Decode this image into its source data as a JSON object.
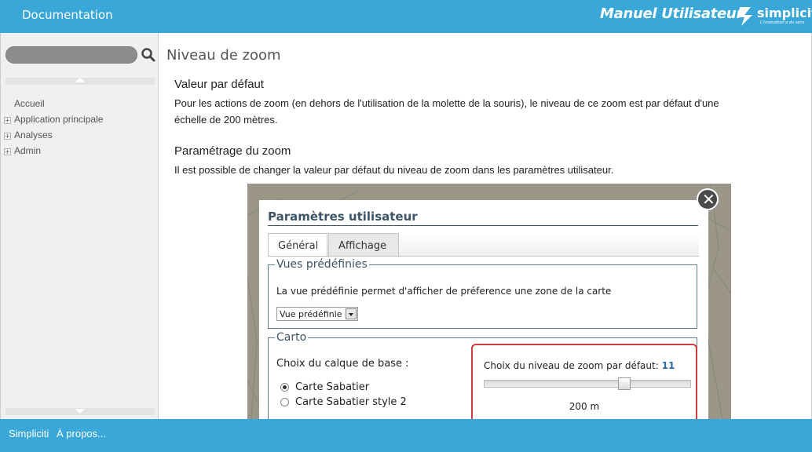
{
  "header": {
    "doc_label": "Documentation",
    "manual_label": "Manuel Utilisateur",
    "logo_name": "simpliciti",
    "logo_tagline": "L'innovation a du sens"
  },
  "sidebar": {
    "search_placeholder": "",
    "items": [
      {
        "label": "Accueil",
        "expandable": false
      },
      {
        "label": "Application principale",
        "expandable": true
      },
      {
        "label": "Analyses",
        "expandable": true
      },
      {
        "label": "Admin",
        "expandable": true
      }
    ]
  },
  "content": {
    "page_title": "Niveau de zoom",
    "section1_title": "Valeur par défaut",
    "section1_line1": "Pour les actions de zoom (en dehors de l'utilisation de la molette de la souris), le niveau de ce zoom est par défaut d'une",
    "section1_line2": "échelle de 200 mètres.",
    "section2_title": "Paramétrage du zoom",
    "section2_text": "Il est possible de changer la valeur par défaut du niveau de zoom dans les paramètres utilisateur."
  },
  "dialog": {
    "title": "Paramètres utilisateur",
    "tabs": [
      "Général",
      "Affichage"
    ],
    "vues": {
      "legend": "Vues prédéfinies",
      "description": "La vue prédéfinie permet d'afficher de préference une zone de la carte",
      "select_value": "Vue prédéfinie"
    },
    "carto": {
      "legend": "Carto",
      "base_layer_label": "Choix du calque de base :",
      "options": [
        "Carte Sabatier",
        "Carte Sabatier style 2"
      ],
      "selected_option": "Carte Sabatier",
      "zoom_label": "Choix du niveau de zoom par défaut:",
      "zoom_level": "11",
      "zoom_fraction": 0.69,
      "zoom_value": "200 m"
    }
  },
  "footer": {
    "link1": "Simpliciti",
    "link2": "À propos..."
  },
  "colors": {
    "brand": "#3aa7d9",
    "highlight": "#d63a3a",
    "dialog_title": "#3b5566"
  }
}
